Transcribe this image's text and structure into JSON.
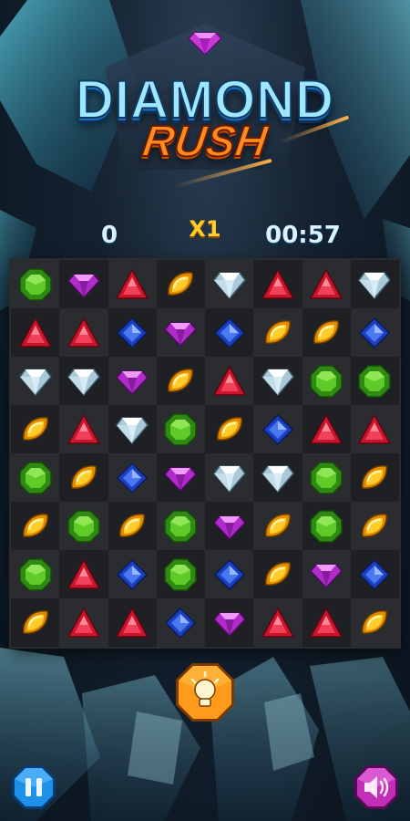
{
  "title": {
    "line1": "DIAMOND",
    "line2": "RUSH"
  },
  "hud": {
    "score": "0",
    "multiplier": "X1",
    "timer": "00:57"
  },
  "board": {
    "rows": 8,
    "cols": 8,
    "grid": [
      [
        "green",
        "purple",
        "red",
        "yellow",
        "white",
        "red",
        "red",
        "white"
      ],
      [
        "red",
        "red",
        "blue",
        "purple",
        "blue",
        "yellow",
        "yellow",
        "blue"
      ],
      [
        "white",
        "white",
        "purple",
        "yellow",
        "red",
        "white",
        "green",
        "green"
      ],
      [
        "yellow",
        "red",
        "white",
        "green",
        "yellow",
        "blue",
        "red",
        "red"
      ],
      [
        "green",
        "yellow",
        "blue",
        "purple",
        "white",
        "white",
        "green",
        "yellow"
      ],
      [
        "yellow",
        "green",
        "yellow",
        "green",
        "purple",
        "yellow",
        "green",
        "yellow"
      ],
      [
        "green",
        "red",
        "blue",
        "green",
        "blue",
        "yellow",
        "purple",
        "blue"
      ],
      [
        "yellow",
        "red",
        "red",
        "blue",
        "purple",
        "red",
        "red",
        "yellow"
      ]
    ]
  },
  "buttons": {
    "hint_icon": "lightbulb-icon",
    "pause_icon": "pause-icon",
    "sound_icon": "speaker-icon"
  },
  "colors": {
    "hint": "#ff9a1a",
    "pause": "#1e90e8",
    "sound": "#c12fb8"
  }
}
